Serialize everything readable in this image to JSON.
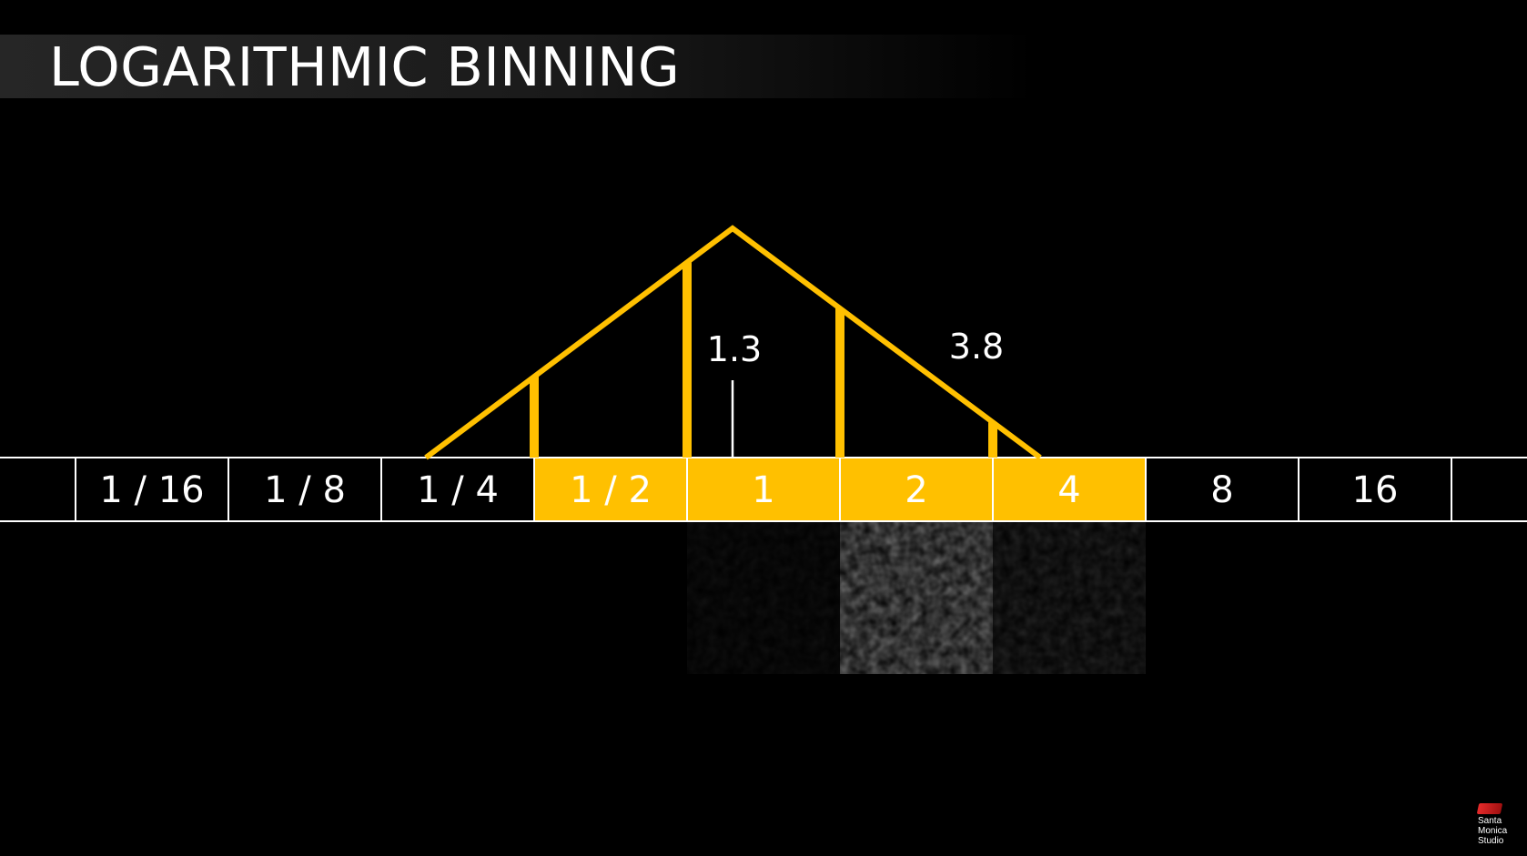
{
  "slide": {
    "title": "LOGARITHMIC BINNING"
  },
  "bins": [
    {
      "label": "",
      "highlighted": false
    },
    {
      "label": "1 / 16",
      "highlighted": false
    },
    {
      "label": "1 / 8",
      "highlighted": false
    },
    {
      "label": "1 / 4",
      "highlighted": false
    },
    {
      "label": "1 / 2",
      "highlighted": true
    },
    {
      "label": "1",
      "highlighted": true
    },
    {
      "label": "2",
      "highlighted": true
    },
    {
      "label": "4",
      "highlighted": true
    },
    {
      "label": "8",
      "highlighted": false
    },
    {
      "label": "16",
      "highlighted": false
    },
    {
      "label": "",
      "highlighted": false
    }
  ],
  "annotations": {
    "center_value": "1.3",
    "width_value": "3.8"
  },
  "noise_tiles": [
    {
      "under_bin": "1",
      "brightness": 0.08
    },
    {
      "under_bin": "2",
      "brightness": 0.55
    },
    {
      "under_bin": "4",
      "brightness": 0.18
    }
  ],
  "colors": {
    "background": "#000000",
    "accent": "#FFC000",
    "text": "#FFFFFF",
    "border": "#FFFFFF",
    "logo_red": "#E62B2B"
  },
  "logo": {
    "brand_mark": "red-wedge-icon",
    "lines": [
      "Santa",
      "Monica",
      "Studio"
    ]
  }
}
